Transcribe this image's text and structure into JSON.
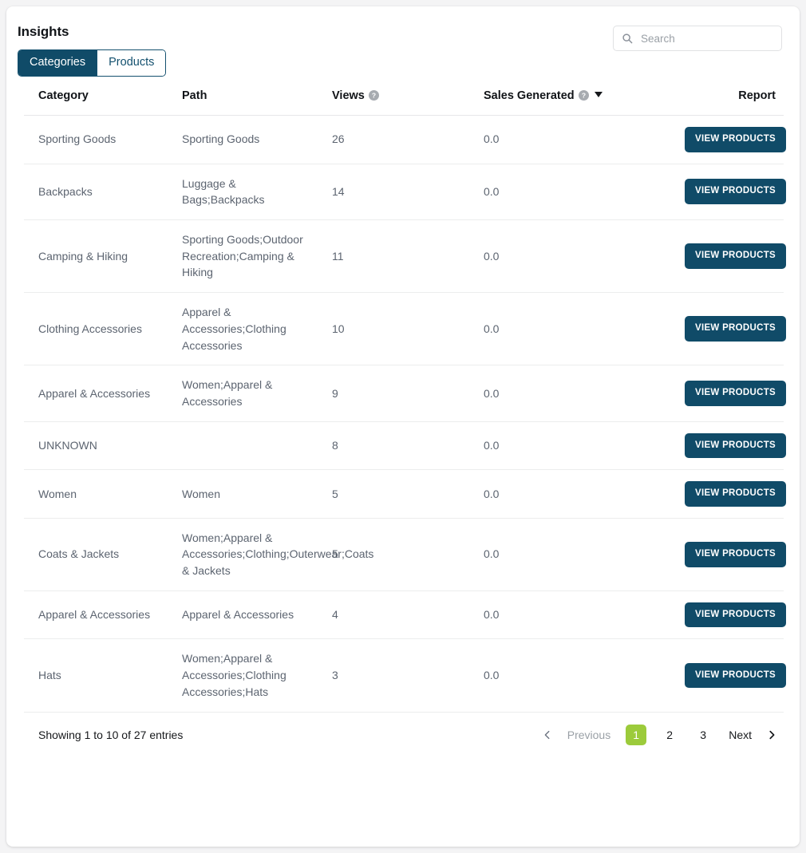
{
  "header": {
    "title": "Insights",
    "tabs": [
      {
        "label": "Categories",
        "active": true
      },
      {
        "label": "Products",
        "active": false
      }
    ]
  },
  "search": {
    "placeholder": "Search",
    "value": "",
    "icon": "search-icon"
  },
  "table": {
    "columns": [
      {
        "key": "category",
        "label": "Category",
        "help": false,
        "sorted": false
      },
      {
        "key": "path",
        "label": "Path",
        "help": false,
        "sorted": false
      },
      {
        "key": "views",
        "label": "Views",
        "help": true,
        "sorted": false
      },
      {
        "key": "sales",
        "label": "Sales Generated",
        "help": true,
        "sorted": true,
        "sort_dir": "desc"
      },
      {
        "key": "report",
        "label": "Report",
        "help": false,
        "sorted": false
      }
    ],
    "row_action_label": "VIEW PRODUCTS",
    "rows": [
      {
        "category": "Sporting Goods",
        "path": "Sporting Goods",
        "views": "26",
        "sales": "0.0"
      },
      {
        "category": "Backpacks",
        "path": "Luggage & Bags;Backpacks",
        "views": "14",
        "sales": "0.0"
      },
      {
        "category": "Camping & Hiking",
        "path": "Sporting Goods;Outdoor Recreation;Camping & Hiking",
        "views": "11",
        "sales": "0.0"
      },
      {
        "category": "Clothing Accessories",
        "path": "Apparel & Accessories;Clothing Accessories",
        "views": "10",
        "sales": "0.0"
      },
      {
        "category": "Apparel & Accessories",
        "path": "Women;Apparel & Accessories",
        "views": "9",
        "sales": "0.0"
      },
      {
        "category": "UNKNOWN",
        "path": "",
        "views": "8",
        "sales": "0.0"
      },
      {
        "category": "Women",
        "path": "Women",
        "views": "5",
        "sales": "0.0"
      },
      {
        "category": "Coats & Jackets",
        "path": "Women;Apparel & Accessories;Clothing;Outerwear;Coats & Jackets",
        "views": "5",
        "sales": "0.0"
      },
      {
        "category": "Apparel & Accessories",
        "path": "Apparel & Accessories",
        "views": "4",
        "sales": "0.0"
      },
      {
        "category": "Hats",
        "path": "Women;Apparel & Accessories;Clothing Accessories;Hats",
        "views": "3",
        "sales": "0.0"
      }
    ]
  },
  "footer": {
    "entries_info": "Showing 1 to 10 of 27 entries",
    "pagination": {
      "previous_label": "Previous",
      "next_label": "Next",
      "pages": [
        "1",
        "2",
        "3"
      ],
      "current_page": "1"
    }
  },
  "colors": {
    "brand_navy": "#104b68",
    "active_page_green": "#9ccb3b",
    "body_text": "#5c6470",
    "heading_text": "#111418"
  }
}
